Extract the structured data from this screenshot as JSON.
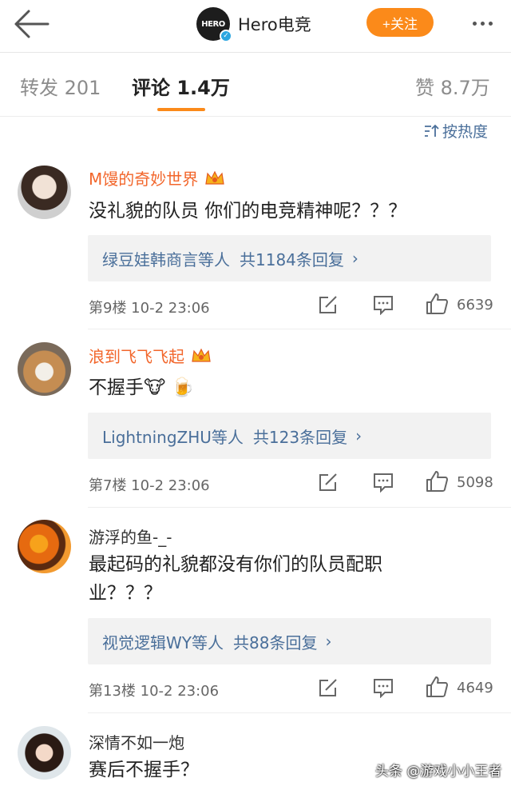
{
  "header": {
    "account_name": "Hero电竞",
    "logo_text": "HERO",
    "follow_label": "+关注",
    "colors": {
      "accent": "#fb8a1a",
      "link": "#4a6f9a",
      "vip_name": "#f2662b"
    }
  },
  "tabs": {
    "repost": "转发 201",
    "comment": "评论 1.4万",
    "like": "赞 8.7万"
  },
  "sort_label": "按热度",
  "comments": [
    {
      "username": "M馒的奇妙世界",
      "vip": true,
      "text": "没礼貌的队员 你们的电竞精神呢？？？",
      "reply_names": "绿豆娃韩商言等人",
      "reply_count": "共1184条回复",
      "floor_time": "第9楼  10-2 23:06",
      "likes": "6639"
    },
    {
      "username": "浪到飞飞飞起",
      "vip": true,
      "text": "不握手🐮 🍺",
      "reply_names": "LightningZHU等人",
      "reply_count": "共123条回复",
      "floor_time": "第7楼  10-2 23:06",
      "likes": "5098"
    },
    {
      "username": "游浮的鱼-_-",
      "vip": false,
      "text": "最起码的礼貌都没有你们的队员配职业？？？",
      "reply_names": "视觉逻辑WY等人",
      "reply_count": "共88条回复",
      "floor_time": "第13楼  10-2 23:06",
      "likes": "4649"
    },
    {
      "username": "深情不如一炮",
      "vip": false,
      "text": "赛后不握手？"
    }
  ],
  "watermark": "头条 @游戏小小王者"
}
